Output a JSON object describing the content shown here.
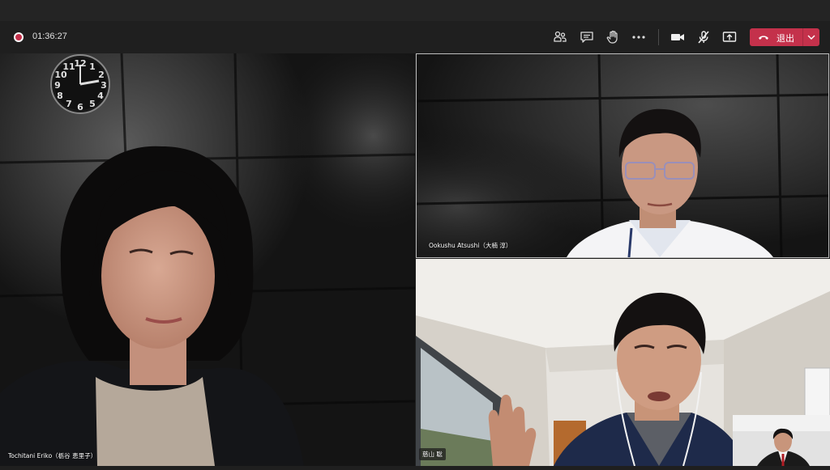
{
  "call": {
    "recording_active": true,
    "duration": "01:36:27"
  },
  "toolbar": {
    "icons": [
      "participants-icon",
      "chat-icon",
      "raise-hand-icon",
      "more-icon",
      "camera-icon",
      "mic-muted-icon",
      "share-screen-icon"
    ],
    "leave_label": "退出",
    "leave_color": "#c4314b"
  },
  "participants": {
    "main": {
      "name": "Tochitani Eriko（栃谷 恵里子）"
    },
    "top_right": {
      "name": "Ookushu Atsushi（大楠 淳）"
    },
    "bottom_right": {
      "name": "慈山 聡"
    }
  },
  "clock": {
    "numerals": [
      "12",
      "1",
      "2",
      "3",
      "4",
      "5",
      "6",
      "7",
      "8",
      "9",
      "10",
      "11"
    ]
  }
}
